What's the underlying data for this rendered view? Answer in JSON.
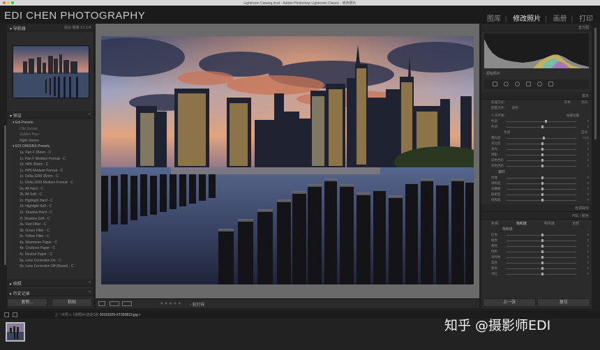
{
  "window": {
    "title": "Lightroom Catalog.lrcat - Adobe Photoshop Lightroom Classic - 修改照片",
    "traffic_colors": [
      "#fd5f57",
      "#febc2e",
      "#28c840"
    ]
  },
  "brand": "EDI CHEN PHOTOGRAPHY",
  "modules": [
    {
      "label": "图库",
      "active": false
    },
    {
      "label": "修改照片",
      "active": true
    },
    {
      "label": "画册",
      "active": false
    },
    {
      "label": "打印",
      "active": false
    }
  ],
  "left": {
    "navigator": {
      "title": "导航器",
      "zoom": "适合",
      "fill": "填满",
      "z1": "1:1",
      "z2": "1:4"
    },
    "presets_title": "预设",
    "presets": [
      {
        "label": "Edi Presets",
        "type": "folder"
      },
      {
        "label": "City Sunset",
        "type": "item-italic"
      },
      {
        "label": "Golden Hour",
        "type": "item-italic"
      },
      {
        "label": "Night Stereo",
        "type": "item"
      },
      {
        "label": "EDI ORIGINS Presets",
        "type": "folder"
      },
      {
        "label": "1a. Pan F 35mm - C",
        "type": "item"
      },
      {
        "label": "1c. Pan F Medium Format - C",
        "type": "item"
      },
      {
        "label": "1b. HP5 35mm - C",
        "type": "item"
      },
      {
        "label": "1c. HP5 Medium Format - C",
        "type": "item"
      },
      {
        "label": "1c. Delta 3200 35mm - C",
        "type": "item"
      },
      {
        "label": "1c. Delta 3200 Medium Format - C",
        "type": "item"
      },
      {
        "label": "2a. All Hard - C",
        "type": "item"
      },
      {
        "label": "2b. All Soft - C",
        "type": "item"
      },
      {
        "label": "2c. Highlight Hard - C",
        "type": "item"
      },
      {
        "label": "2d. Highlight Soft - C",
        "type": "item"
      },
      {
        "label": "2e. Shadow Hard - C",
        "type": "item"
      },
      {
        "label": "2f. Shadow Soft - C",
        "type": "item"
      },
      {
        "label": "3a. Red Filter - C",
        "type": "item"
      },
      {
        "label": "3b. Green Filter - C",
        "type": "item"
      },
      {
        "label": "3c. Yellow Filter - C",
        "type": "item"
      },
      {
        "label": "4a. Warmtone Paper - C",
        "type": "item"
      },
      {
        "label": "4b. Cooltone Paper - C",
        "type": "item"
      },
      {
        "label": "4c. Neutral Paper - C",
        "type": "item"
      },
      {
        "label": "5a. Lens Correction On - C",
        "type": "item"
      },
      {
        "label": "5b. Lens Correction Off (Reset) - C",
        "type": "item"
      }
    ],
    "snapshots_title": "快照",
    "history_title": "历史记录",
    "copy_button": "复制...",
    "paste_button": "粘贴"
  },
  "toolbar": {
    "stars": "★★★★★",
    "soft_proof": "软打样"
  },
  "right": {
    "histogram_title": "直方图",
    "original_photo": "原始照片",
    "basic_title": "基本",
    "treatment_label": "处理方式：",
    "treatment_color": "彩色",
    "treatment_bw": "黑白",
    "profile_label": "配置文件：",
    "profile_value": "颜色",
    "wb_label": "白平衡：",
    "wb_value": "拍摄设置",
    "basic_rows": [
      {
        "label": "色温",
        "pos": 0.55,
        "val": "0"
      },
      {
        "label": "色调",
        "pos": 0.5,
        "val": "0"
      }
    ],
    "tone_label": "色调",
    "auto_label": "自动",
    "tone_rows": [
      {
        "label": "曝光度",
        "pos": 0.52,
        "val": "0.00"
      },
      {
        "label": "对比度",
        "pos": 0.5,
        "val": "0"
      },
      {
        "label": "高光",
        "pos": 0.5,
        "val": "0"
      },
      {
        "label": "阴影",
        "pos": 0.5,
        "val": "0"
      },
      {
        "label": "白色色阶",
        "pos": 0.5,
        "val": "0"
      },
      {
        "label": "黑色色阶",
        "pos": 0.5,
        "val": "0"
      }
    ],
    "presence_label": "偏好",
    "presence_rows": [
      {
        "label": "纹理",
        "pos": 0.5,
        "val": "0"
      },
      {
        "label": "清晰度",
        "pos": 0.5,
        "val": "0"
      },
      {
        "label": "去朦胧",
        "pos": 0.5,
        "val": "0"
      },
      {
        "label": "鲜艳度",
        "pos": 0.5,
        "val": "0"
      },
      {
        "label": "饱和度",
        "pos": 0.5,
        "val": "0"
      }
    ],
    "tonecurve_title": "色调曲线",
    "hsl_title": "HSL / 颜色",
    "hsl_tabs": [
      "色相",
      "饱和度",
      "明亮度",
      "全部"
    ],
    "hsl_sub": "饱和度",
    "hsl_rows": [
      {
        "label": "红色",
        "pos": 0.5,
        "val": "0"
      },
      {
        "label": "橙色",
        "pos": 0.5,
        "val": "0"
      },
      {
        "label": "黄色",
        "pos": 0.5,
        "val": "0"
      },
      {
        "label": "绿色",
        "pos": 0.5,
        "val": "0"
      },
      {
        "label": "浅绿色",
        "pos": 0.5,
        "val": "0"
      },
      {
        "label": "蓝色",
        "pos": 0.5,
        "val": "0"
      },
      {
        "label": "紫色",
        "pos": 0.5,
        "val": "0"
      },
      {
        "label": "洋红",
        "pos": 0.5,
        "val": "0"
      }
    ],
    "prev_button": "上一张",
    "reset_button": "复位"
  },
  "filmbar": {
    "crumb_prefix": "上一次导入",
    "crumb_count": "1张照片/选定1张",
    "filename": "20181029-XT350815.jpg"
  },
  "watermark": "知乎 @摄影师EDI"
}
